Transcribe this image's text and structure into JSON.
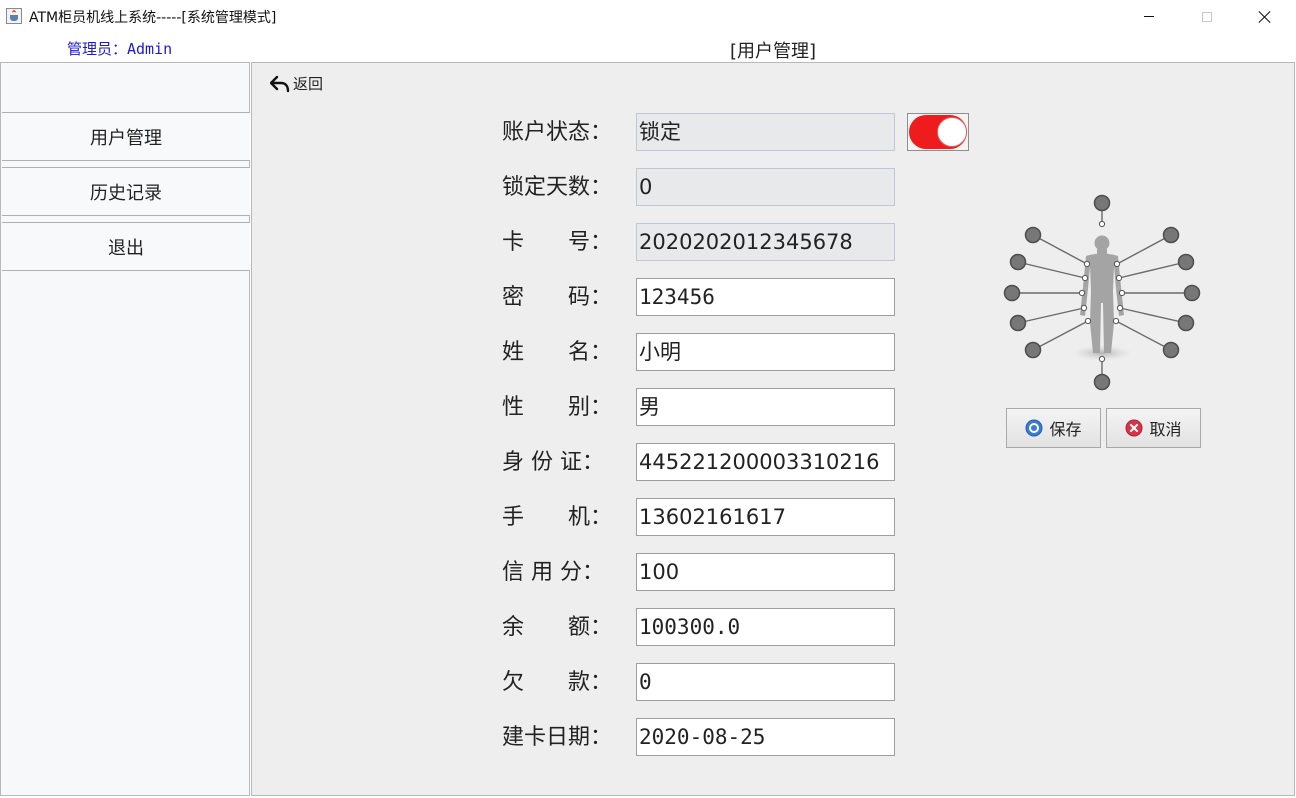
{
  "window": {
    "title": "ATM柜员机线上系统-----[系统管理模式]"
  },
  "header": {
    "admin_label": "管理员：Admin",
    "page_title": "[用户管理]"
  },
  "sidebar": {
    "items": [
      {
        "label": "用户管理"
      },
      {
        "label": "历史记录"
      },
      {
        "label": "退出"
      }
    ]
  },
  "main": {
    "back_label": "返回",
    "fields": [
      {
        "label": "账户状态：",
        "value": "锁定",
        "editable": false
      },
      {
        "label": "锁定天数：",
        "value": "0",
        "editable": false
      },
      {
        "label": "卡　　号：",
        "value": "2020202012345678",
        "editable": false
      },
      {
        "label": "密　　码：",
        "value": "123456",
        "editable": true
      },
      {
        "label": "姓　　名：",
        "value": "小明",
        "editable": true
      },
      {
        "label": "性　　别：",
        "value": "男",
        "editable": true
      },
      {
        "label": "身 份 证：",
        "value": "445221200003310216",
        "editable": true
      },
      {
        "label": "手　　机：",
        "value": "13602161617",
        "editable": true
      },
      {
        "label": "信 用 分：",
        "value": "100",
        "editable": true
      },
      {
        "label": "余　　额：",
        "value": "100300.0",
        "editable": true
      },
      {
        "label": "欠　　款：",
        "value": "0",
        "editable": true
      },
      {
        "label": "建卡日期：",
        "value": "2020-08-25",
        "editable": true
      }
    ],
    "lock_toggle": {
      "on": true,
      "color": "#ee1c1c"
    },
    "save_label": "保存",
    "cancel_label": "取消"
  },
  "colors": {
    "admin_text": "#1a1ad4",
    "toggle_on": "#ee1c1c",
    "panel_bg": "#eeeeee",
    "sidebar_bg": "#f7f8fa"
  }
}
